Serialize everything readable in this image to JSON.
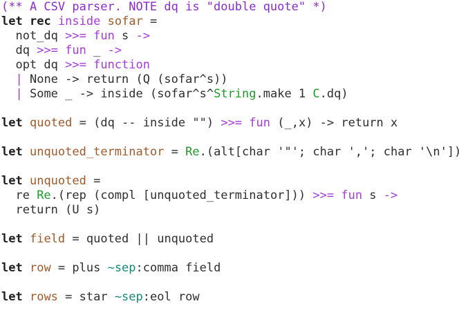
{
  "editor": {
    "language": "OCaml",
    "colors": {
      "keyword": "#1f1f1f",
      "keyword_secondary": "#a63bd6",
      "definition": "#a15a2a",
      "module": "#1f9a2a",
      "label": "#16887a",
      "comment": "#8b2bd0",
      "text": "#2e2e2e",
      "background": "#ffffff"
    },
    "lines": [
      [
        {
          "t": "(** A CSV parser. NOTE dq is \"double quote\" *)",
          "c": "cmt"
        }
      ],
      [
        {
          "t": "let",
          "c": "kw"
        },
        {
          "t": " ",
          "c": "plain"
        },
        {
          "t": "rec",
          "c": "kw"
        },
        {
          "t": " ",
          "c": "plain"
        },
        {
          "t": "inside",
          "c": "kw2"
        },
        {
          "t": " ",
          "c": "plain"
        },
        {
          "t": "sofar",
          "c": "def"
        },
        {
          "t": " =",
          "c": "plain"
        }
      ],
      [
        {
          "t": "  not_dq ",
          "c": "plain"
        },
        {
          "t": ">>=",
          "c": "op"
        },
        {
          "t": " ",
          "c": "plain"
        },
        {
          "t": "fun",
          "c": "kw2"
        },
        {
          "t": " s ",
          "c": "plain"
        },
        {
          "t": "->",
          "c": "op"
        }
      ],
      [
        {
          "t": "  dq ",
          "c": "plain"
        },
        {
          "t": ">>=",
          "c": "op"
        },
        {
          "t": " ",
          "c": "plain"
        },
        {
          "t": "fun",
          "c": "kw2"
        },
        {
          "t": " _ ",
          "c": "plain"
        },
        {
          "t": "->",
          "c": "op"
        }
      ],
      [
        {
          "t": "  opt dq ",
          "c": "plain"
        },
        {
          "t": ">>=",
          "c": "op"
        },
        {
          "t": " ",
          "c": "plain"
        },
        {
          "t": "function",
          "c": "kw2"
        }
      ],
      [
        {
          "t": "  ",
          "c": "plain"
        },
        {
          "t": "|",
          "c": "op"
        },
        {
          "t": " None -> return (Q (sofar^s))",
          "c": "plain"
        }
      ],
      [
        {
          "t": "  ",
          "c": "plain"
        },
        {
          "t": "|",
          "c": "op"
        },
        {
          "t": " Some _ -> inside (sofar^s^",
          "c": "plain"
        },
        {
          "t": "String",
          "c": "mod"
        },
        {
          "t": ".make 1 ",
          "c": "plain"
        },
        {
          "t": "C",
          "c": "mod"
        },
        {
          "t": ".dq)",
          "c": "plain"
        }
      ],
      [],
      [
        {
          "t": "let",
          "c": "kw"
        },
        {
          "t": " ",
          "c": "plain"
        },
        {
          "t": "quoted",
          "c": "def"
        },
        {
          "t": " = (dq -- inside \"\") ",
          "c": "plain"
        },
        {
          "t": ">>=",
          "c": "op"
        },
        {
          "t": " ",
          "c": "plain"
        },
        {
          "t": "fun",
          "c": "kw2"
        },
        {
          "t": " (_,x) -> return x",
          "c": "plain"
        }
      ],
      [],
      [
        {
          "t": "let",
          "c": "kw"
        },
        {
          "t": " ",
          "c": "plain"
        },
        {
          "t": "unquoted_terminator",
          "c": "def"
        },
        {
          "t": " = ",
          "c": "plain"
        },
        {
          "t": "Re",
          "c": "mod"
        },
        {
          "t": ".(alt[char '\"'; char ','; char '\\n'])",
          "c": "plain"
        }
      ],
      [],
      [
        {
          "t": "let",
          "c": "kw"
        },
        {
          "t": " ",
          "c": "plain"
        },
        {
          "t": "unquoted",
          "c": "def"
        },
        {
          "t": " =",
          "c": "plain"
        }
      ],
      [
        {
          "t": "  re ",
          "c": "plain"
        },
        {
          "t": "Re",
          "c": "mod"
        },
        {
          "t": ".(rep (compl [unquoted_terminator])) ",
          "c": "plain"
        },
        {
          "t": ">>=",
          "c": "op"
        },
        {
          "t": " ",
          "c": "plain"
        },
        {
          "t": "fun",
          "c": "kw2"
        },
        {
          "t": " s ",
          "c": "plain"
        },
        {
          "t": "->",
          "c": "op"
        }
      ],
      [
        {
          "t": "  return (U s)",
          "c": "plain"
        }
      ],
      [],
      [
        {
          "t": "let",
          "c": "kw"
        },
        {
          "t": " ",
          "c": "plain"
        },
        {
          "t": "field",
          "c": "def"
        },
        {
          "t": " = quoted || unquoted",
          "c": "plain"
        }
      ],
      [],
      [
        {
          "t": "let",
          "c": "kw"
        },
        {
          "t": " ",
          "c": "plain"
        },
        {
          "t": "row",
          "c": "def"
        },
        {
          "t": " = plus ",
          "c": "plain"
        },
        {
          "t": "~sep",
          "c": "lbl"
        },
        {
          "t": ":comma field",
          "c": "plain"
        }
      ],
      [],
      [
        {
          "t": "let",
          "c": "kw"
        },
        {
          "t": " ",
          "c": "plain"
        },
        {
          "t": "rows",
          "c": "def"
        },
        {
          "t": " = star ",
          "c": "plain"
        },
        {
          "t": "~sep",
          "c": "lbl"
        },
        {
          "t": ":eol row",
          "c": "plain"
        }
      ]
    ]
  }
}
